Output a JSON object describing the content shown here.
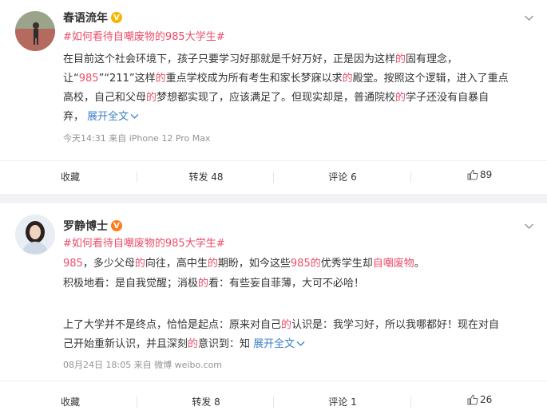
{
  "posts": [
    {
      "author": "春语流年",
      "hashtag": "#如何看待自嘲废物的985大学生#",
      "lines": [
        [
          {
            "t": "在目前这个社会环境下，孩子只要学习好那就是千好万好，正是因为这样"
          },
          {
            "t": "的",
            "h": true
          },
          {
            "t": "固有理念，"
          }
        ],
        [
          {
            "t": "让“"
          },
          {
            "t": "985",
            "h": true
          },
          {
            "t": "”“211”这样"
          },
          {
            "t": "的",
            "h": true
          },
          {
            "t": "重点学校成为所有考生和家长梦寐以求"
          },
          {
            "t": "的",
            "h": true
          },
          {
            "t": "殿堂。按照这个逻辑，进入了重点"
          }
        ],
        [
          {
            "t": "高校，自己和父母"
          },
          {
            "t": "的",
            "h": true
          },
          {
            "t": "梦想都实现了，应该满足了。但现实却是，普通院校"
          },
          {
            "t": "的",
            "h": true
          },
          {
            "t": "学子还没有自暴自"
          }
        ],
        [
          {
            "t": "弃，  "
          }
        ]
      ],
      "expand": "展开全文",
      "meta": "今天14:31  来自 iPhone 12 Pro Max",
      "actions": {
        "collect": "收藏",
        "repost": "转发 48",
        "comment": "评论 6",
        "like": "89"
      }
    },
    {
      "author": "罗静博士",
      "hashtag": "#如何看待自嘲废物的985大学生#",
      "lines": [
        [
          {
            "t": "985",
            "h": true
          },
          {
            "t": "，多少父母"
          },
          {
            "t": "的",
            "h": true
          },
          {
            "t": "向往，高中生"
          },
          {
            "t": "的",
            "h": true
          },
          {
            "t": "期盼，如今这些"
          },
          {
            "t": "985",
            "h": true
          },
          {
            "t": "的",
            "h": true
          },
          {
            "t": "优秀学生却"
          },
          {
            "t": "自嘲废物",
            "h": true
          },
          {
            "t": "。"
          }
        ],
        [
          {
            "t": "积极地看：是自我觉醒；消极"
          },
          {
            "t": "的",
            "h": true
          },
          {
            "t": "看：有些妄自菲薄，大可不必哈！"
          }
        ],
        [],
        [
          {
            "t": "上了大学并不是终点，恰恰是起点：原来对自己"
          },
          {
            "t": "的",
            "h": true
          },
          {
            "t": "认识是：我学习好，所以我哪都好！现在对自"
          }
        ],
        [
          {
            "t": "己开始重新认识，并且深刻"
          },
          {
            "t": "的",
            "h": true
          },
          {
            "t": "意识到：知  "
          }
        ]
      ],
      "expand": "展开全文",
      "meta": "08月24日 18:05  来自 微博 weibo.com",
      "actions": {
        "collect": "收藏",
        "repost": "转发 8",
        "comment": "评论 1",
        "like": "26"
      }
    }
  ],
  "icons": {
    "verified": "verified-badge-icon",
    "more": "chevron-down-icon",
    "like": "thumbs-up-icon",
    "expand": "chevron-down-icon"
  },
  "colors": {
    "hashtag": "#eb4d6a",
    "highlight": "#eb4d6a",
    "link": "#3a7fc4",
    "meta": "#939393"
  }
}
